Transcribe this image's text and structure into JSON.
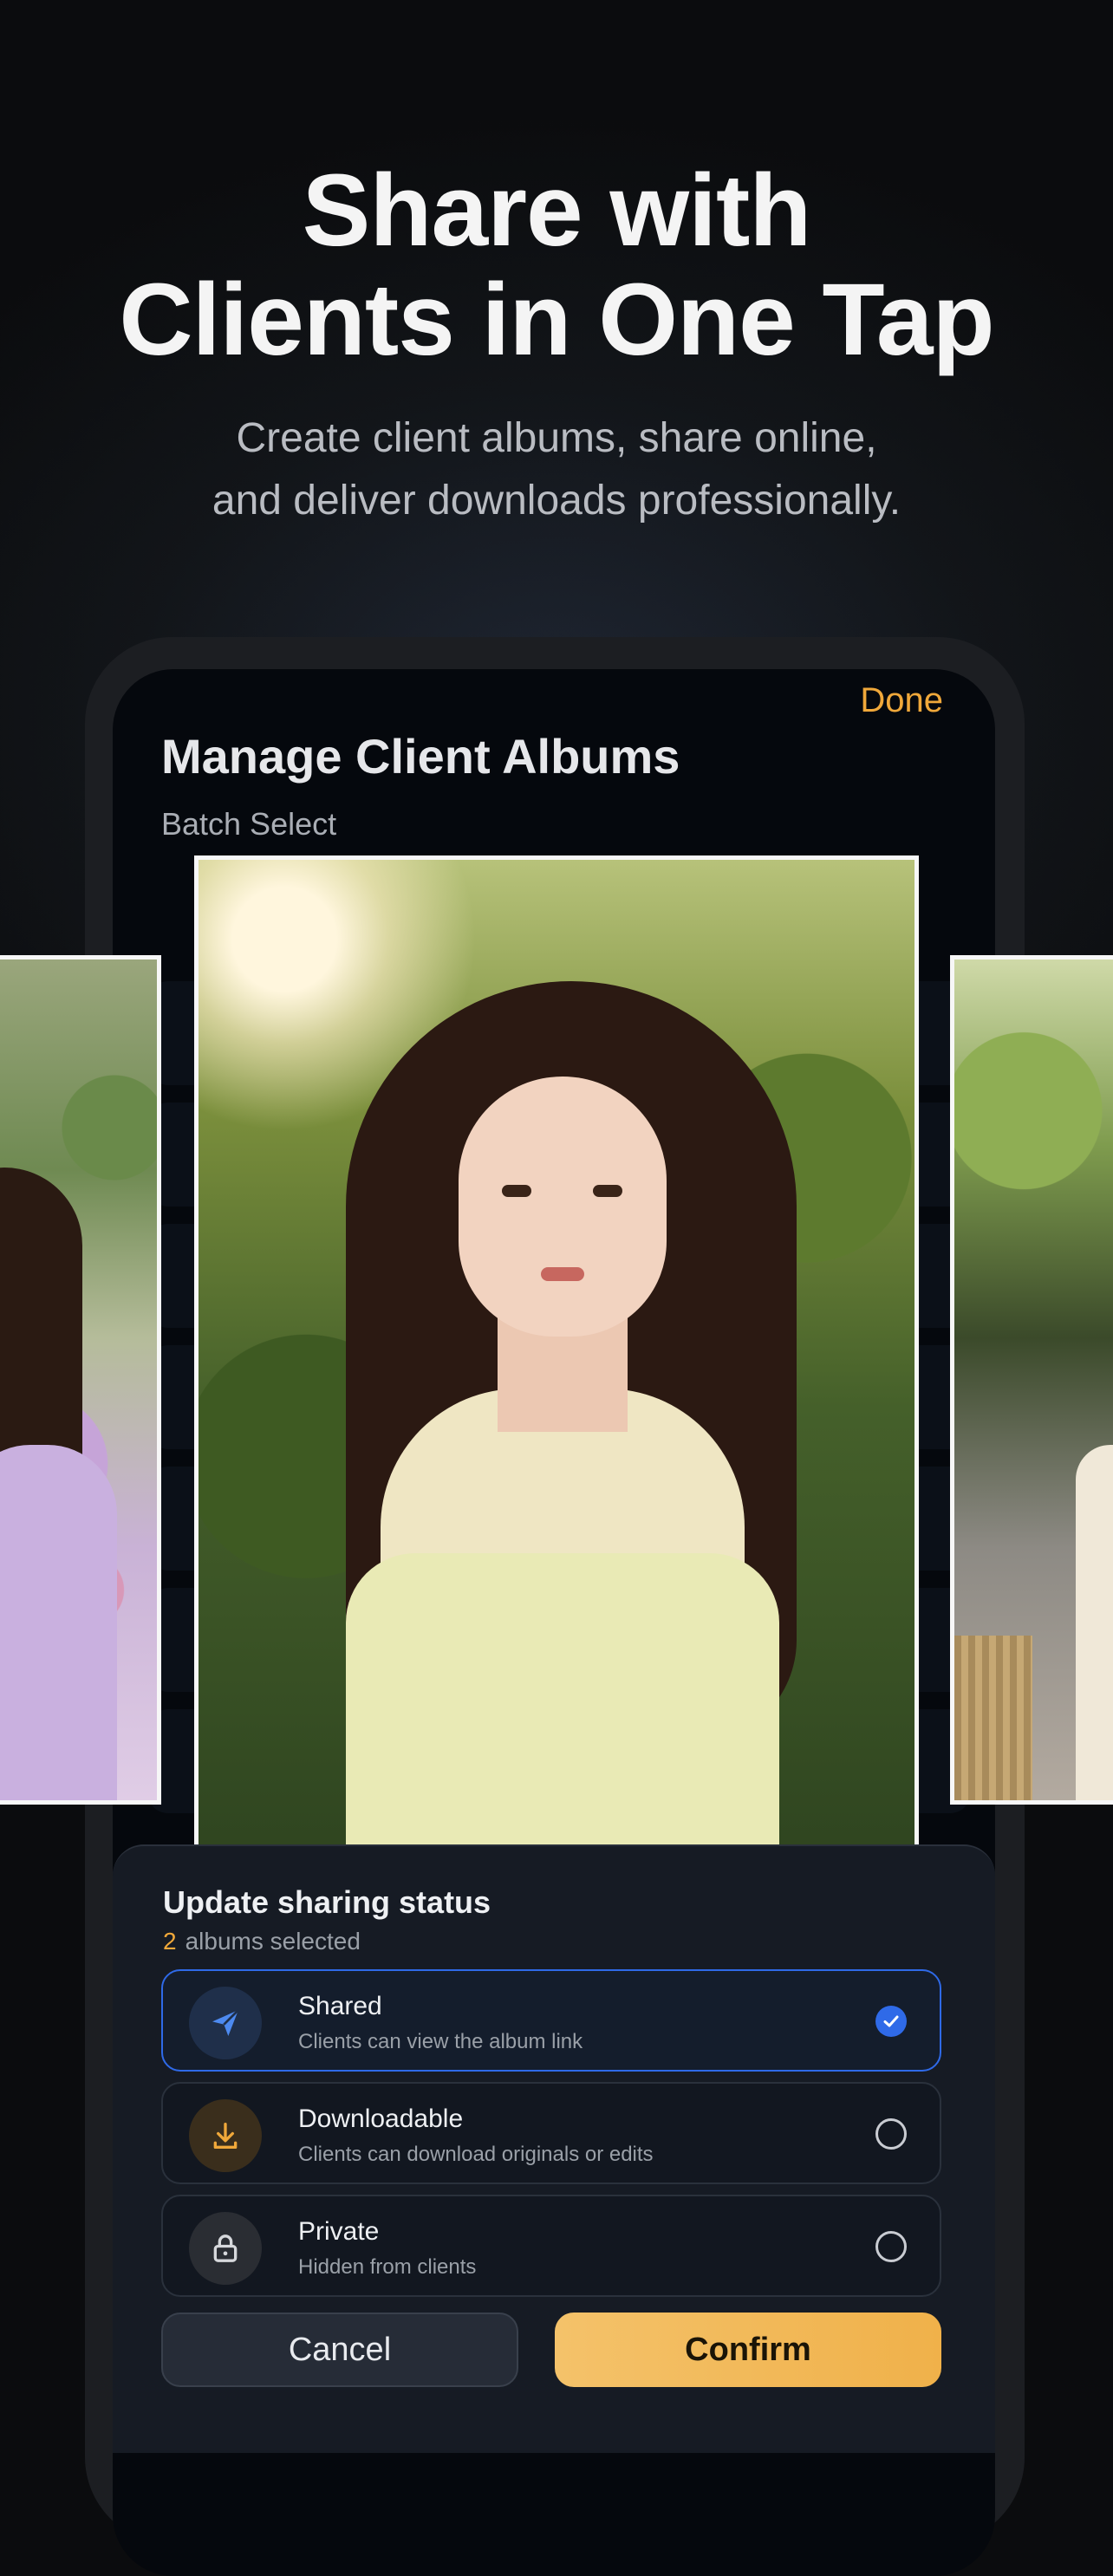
{
  "hero": {
    "headline_line1": "Share with",
    "headline_line2": "Clients in One Tap",
    "subhead_line1": "Create client albums, share online,",
    "subhead_line2": "and deliver downloads professionally."
  },
  "screen": {
    "done_label": "Done",
    "title": "Manage Client Albums",
    "batch_select": "Batch Select"
  },
  "sheet": {
    "title": "Update sharing status",
    "selected_count": "2",
    "selected_suffix": "albums selected",
    "options": [
      {
        "label": "Shared",
        "desc": "Clients can view the album link",
        "icon": "send-icon",
        "selected": true
      },
      {
        "label": "Downloadable",
        "desc": "Clients can download originals or edits",
        "icon": "download-icon",
        "selected": false
      },
      {
        "label": "Private",
        "desc": "Hidden from clients",
        "icon": "lock-icon",
        "selected": false
      }
    ],
    "cancel_label": "Cancel",
    "confirm_label": "Confirm"
  },
  "colors": {
    "accent_orange": "#f0a83a",
    "accent_blue": "#2f6ae8",
    "confirm_gold": "#f4c26a"
  }
}
